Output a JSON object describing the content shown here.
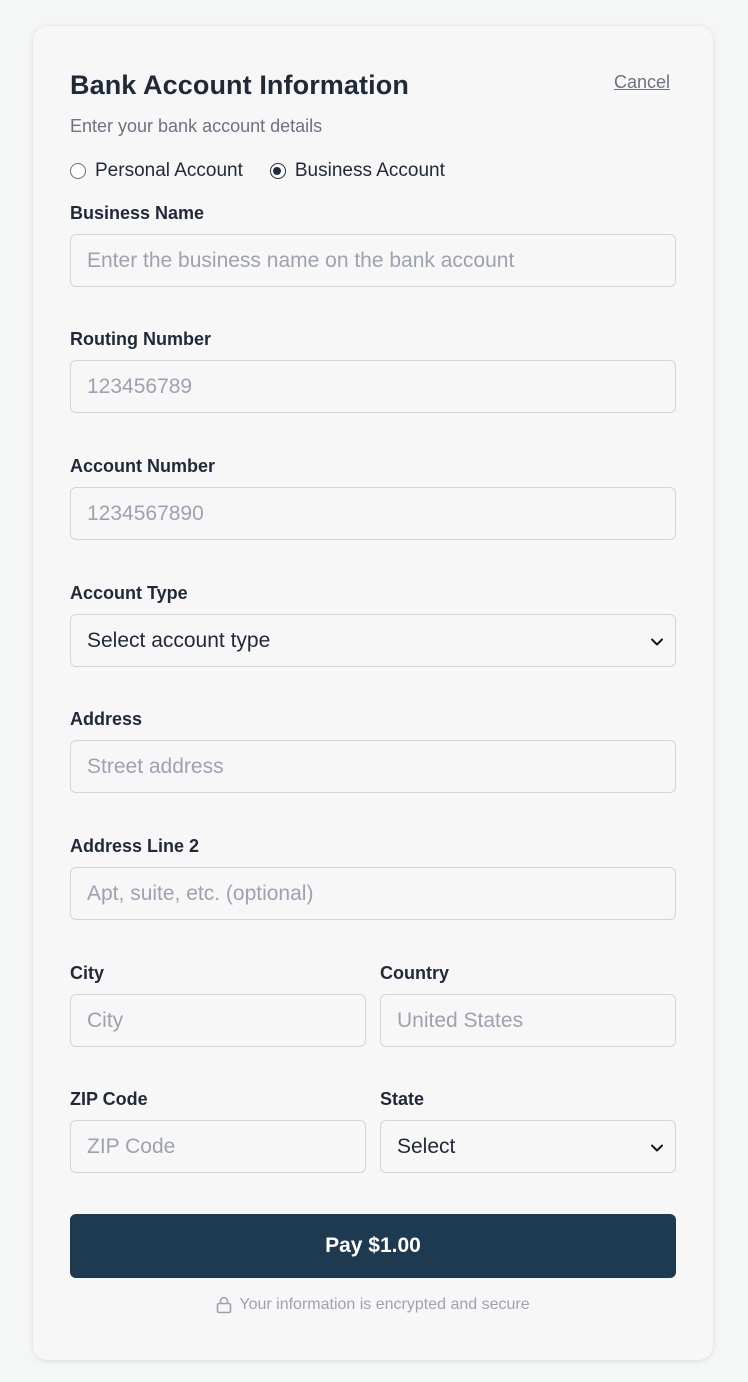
{
  "header": {
    "title": "Bank Account Information",
    "cancel_label": "Cancel",
    "subtitle": "Enter your bank account details"
  },
  "account_kind": {
    "options": [
      "Personal Account",
      "Business Account"
    ],
    "selected": "Business Account"
  },
  "fields": {
    "business_name": {
      "label": "Business Name",
      "placeholder": "Enter the business name on the bank account",
      "value": ""
    },
    "routing_number": {
      "label": "Routing Number",
      "placeholder": "123456789",
      "value": ""
    },
    "account_number": {
      "label": "Account Number",
      "placeholder": "1234567890",
      "value": ""
    },
    "account_type": {
      "label": "Account Type",
      "selected": "Select account type"
    },
    "address": {
      "label": "Address",
      "placeholder": "Street address",
      "value": ""
    },
    "address_line_2": {
      "label": "Address Line 2",
      "placeholder": "Apt, suite, etc. (optional)",
      "value": ""
    },
    "city": {
      "label": "City",
      "placeholder": "City",
      "value": ""
    },
    "country": {
      "label": "Country",
      "placeholder": "United States",
      "value": ""
    },
    "zip": {
      "label": "ZIP Code",
      "placeholder": "ZIP Code",
      "value": ""
    },
    "state": {
      "label": "State",
      "selected": "Select"
    }
  },
  "pay_button": {
    "label": "Pay $1.00"
  },
  "footer": {
    "secure_text": "Your information is encrypted and secure"
  },
  "colors": {
    "primary": "#1e3a50",
    "muted": "#6b7280",
    "border": "#d1d5db"
  },
  "icons": {
    "secure": "lock-icon",
    "select": "chevron-down-icon"
  }
}
